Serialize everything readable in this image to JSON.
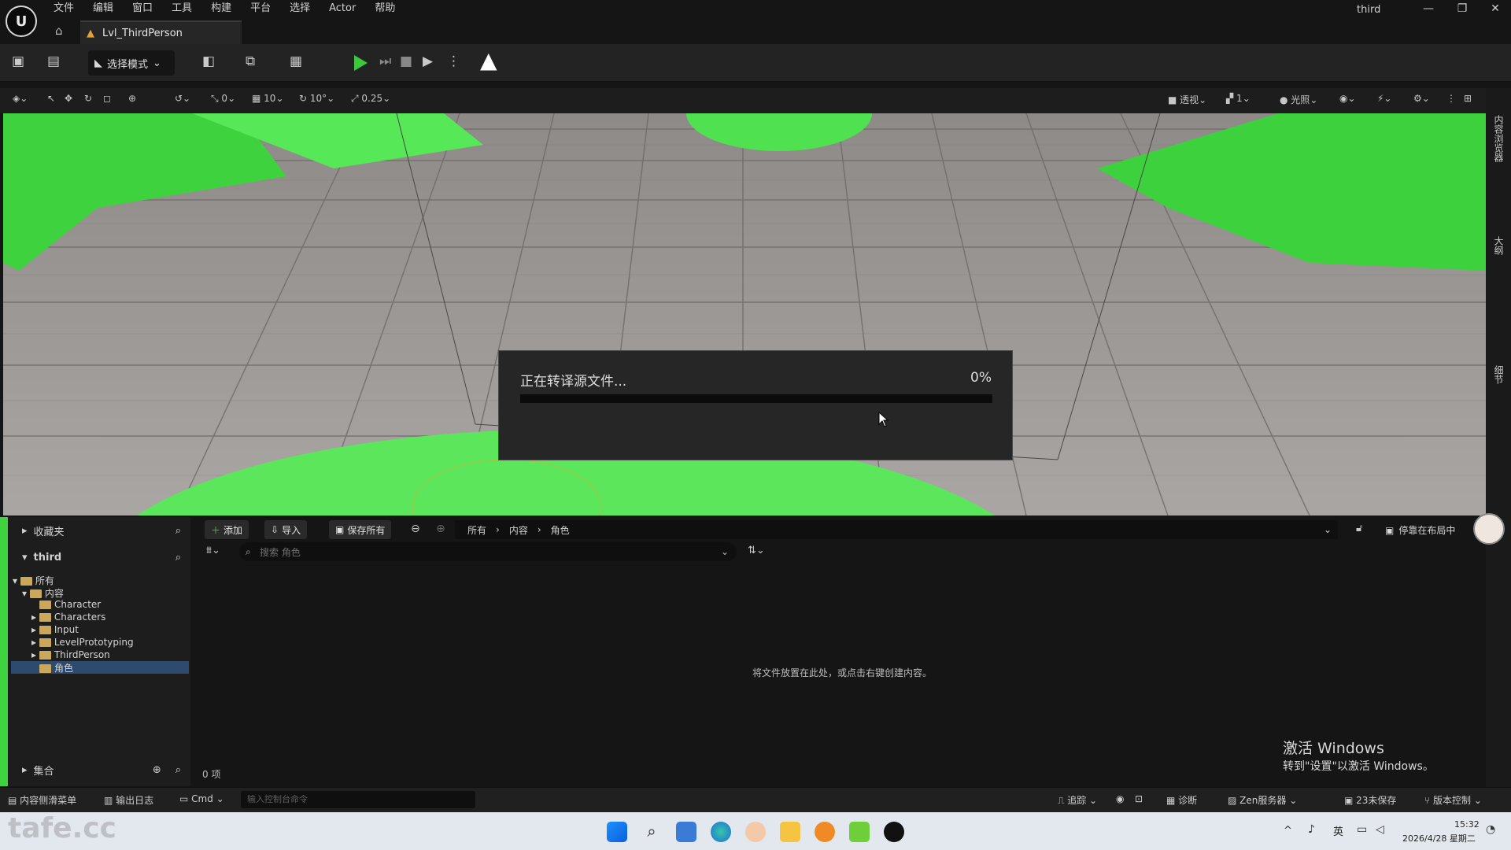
{
  "app": {
    "window_title": "third",
    "logo": "unreal-logo-icon"
  },
  "menu": [
    "文件",
    "编辑",
    "窗口",
    "工具",
    "构建",
    "平台",
    "选择",
    "Actor",
    "帮助"
  ],
  "tab": {
    "label": "Lvl_ThirdPerson"
  },
  "toolbar": {
    "mode_label": "选择模式"
  },
  "viewport_toolbar": {
    "rot_snap": "0",
    "grid_snap": "10",
    "rotation_snap": "10°",
    "scale_snap": "0.25",
    "view_mode": "透视",
    "fov_count": "1",
    "lighting": "光照"
  },
  "side_strip": {
    "item1": "内容浏览器",
    "item2": "大纲",
    "item3": "细节"
  },
  "dialog": {
    "message": "正在转译源文件...",
    "percent_label": "0%",
    "progress": 0
  },
  "content_browser": {
    "favorites_label": "收藏夹",
    "project_label": "third",
    "tree_root": "所有",
    "tree_content": "内容",
    "folders": [
      "Character",
      "Characters",
      "Input",
      "LevelPrototyping",
      "ThirdPerson",
      "角色"
    ],
    "selected_folder": "角色",
    "collections_label": "集合",
    "add_label": "添加",
    "import_label": "导入",
    "save_all_label": "保存所有",
    "breadcrumb": [
      "所有",
      "内容",
      "角色"
    ],
    "dock_label": "停靠在布局中",
    "search_placeholder": "搜索 角色",
    "empty_message": "将文件放置在此处，或点击右键创建内容。",
    "item_count": "0 项"
  },
  "activation": {
    "line1": "激活 Windows",
    "line2": "转到\"设置\"以激活 Windows。"
  },
  "statusbar": {
    "content_drawer": "内容侧滑菜单",
    "output_log": "输出日志",
    "cmd": "Cmd",
    "console_placeholder": "输入控制台命令",
    "trace": "追踪",
    "diagnostics": "诊断",
    "zen_server": "Zen服务器",
    "unsaved": "23未保存",
    "source_control": "版本控制"
  },
  "taskbar": {
    "ime": "英",
    "time": "15:32",
    "date": "2026/4/28 星期二"
  },
  "colors": {
    "accent_green": "#3cc83c",
    "progress_blue": "#2f7dd0",
    "folder": "#c9a85c",
    "selected": "#2e4a6f"
  }
}
